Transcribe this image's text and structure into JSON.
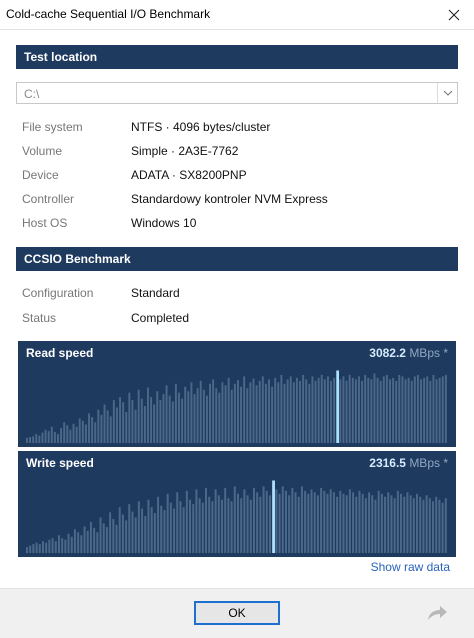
{
  "window": {
    "title": "Cold-cache Sequential I/O Benchmark"
  },
  "icons": {
    "close": "close-icon",
    "dropdown": "chevron-down-icon",
    "share": "share-arrow-icon"
  },
  "colors": {
    "header": "#1f3a5f",
    "bar": "#4c6889",
    "marker": "#aee0ff",
    "link": "#2a62b8"
  },
  "location": {
    "header": "Test location",
    "drive": "C:\\",
    "rows": [
      {
        "key": "File system",
        "value": "NTFS  ·  4096 bytes/cluster"
      },
      {
        "key": "Volume",
        "value": "Simple  ·  2A3E-7762"
      },
      {
        "key": "Device",
        "value": "ADATA  ·  SX8200PNP"
      },
      {
        "key": "Controller",
        "value": "Standardowy kontroler NVM Express"
      },
      {
        "key": "Host OS",
        "value": "Windows 10"
      }
    ]
  },
  "benchmark": {
    "header": "CCSIO Benchmark",
    "rows": [
      {
        "key": "Configuration",
        "value": "Standard"
      },
      {
        "key": "Status",
        "value": "Completed"
      }
    ]
  },
  "read": {
    "label": "Read speed",
    "value": "3082.2",
    "unit": "MBps *",
    "marker_index": 100,
    "levels": [
      0.07,
      0.08,
      0.09,
      0.12,
      0.1,
      0.14,
      0.18,
      0.16,
      0.22,
      0.15,
      0.12,
      0.2,
      0.28,
      0.24,
      0.18,
      0.26,
      0.22,
      0.33,
      0.3,
      0.25,
      0.4,
      0.35,
      0.28,
      0.45,
      0.38,
      0.52,
      0.44,
      0.36,
      0.58,
      0.48,
      0.62,
      0.55,
      0.42,
      0.68,
      0.58,
      0.45,
      0.72,
      0.6,
      0.5,
      0.75,
      0.62,
      0.52,
      0.7,
      0.58,
      0.66,
      0.78,
      0.64,
      0.56,
      0.8,
      0.68,
      0.6,
      0.76,
      0.7,
      0.82,
      0.66,
      0.74,
      0.84,
      0.72,
      0.64,
      0.8,
      0.86,
      0.74,
      0.68,
      0.82,
      0.78,
      0.88,
      0.72,
      0.8,
      0.85,
      0.76,
      0.9,
      0.74,
      0.82,
      0.87,
      0.78,
      0.84,
      0.9,
      0.8,
      0.86,
      0.76,
      0.88,
      0.82,
      0.92,
      0.8,
      0.86,
      0.9,
      0.82,
      0.88,
      0.84,
      0.92,
      0.86,
      0.8,
      0.9,
      0.84,
      0.88,
      0.92,
      0.86,
      0.9,
      0.84,
      0.88,
      0.98,
      0.86,
      0.9,
      0.84,
      0.92,
      0.88,
      0.86,
      0.9,
      0.84,
      0.92,
      0.88,
      0.86,
      0.94,
      0.88,
      0.84,
      0.9,
      0.92,
      0.86,
      0.88,
      0.84,
      0.92,
      0.9,
      0.86,
      0.88,
      0.84,
      0.9,
      0.92,
      0.86,
      0.88,
      0.9,
      0.84,
      0.92,
      0.86,
      0.88,
      0.9,
      0.92
    ]
  },
  "write": {
    "label": "Write speed",
    "value": "2316.5",
    "unit": "MBps *",
    "marker_index": 77,
    "levels": [
      0.08,
      0.1,
      0.12,
      0.14,
      0.12,
      0.16,
      0.14,
      0.18,
      0.2,
      0.16,
      0.24,
      0.2,
      0.18,
      0.26,
      0.22,
      0.32,
      0.28,
      0.24,
      0.36,
      0.3,
      0.42,
      0.34,
      0.28,
      0.48,
      0.4,
      0.35,
      0.55,
      0.46,
      0.38,
      0.62,
      0.52,
      0.44,
      0.66,
      0.56,
      0.48,
      0.7,
      0.6,
      0.5,
      0.72,
      0.62,
      0.54,
      0.76,
      0.64,
      0.58,
      0.8,
      0.68,
      0.6,
      0.82,
      0.7,
      0.62,
      0.84,
      0.72,
      0.66,
      0.86,
      0.74,
      0.68,
      0.88,
      0.76,
      0.7,
      0.86,
      0.78,
      0.72,
      0.88,
      0.74,
      0.7,
      0.9,
      0.8,
      0.74,
      0.86,
      0.78,
      0.72,
      0.88,
      0.82,
      0.76,
      0.9,
      0.84,
      0.78,
      0.98,
      0.86,
      0.8,
      0.9,
      0.84,
      0.78,
      0.88,
      0.82,
      0.76,
      0.9,
      0.84,
      0.8,
      0.86,
      0.82,
      0.78,
      0.88,
      0.84,
      0.8,
      0.86,
      0.82,
      0.76,
      0.84,
      0.8,
      0.78,
      0.86,
      0.82,
      0.76,
      0.84,
      0.8,
      0.74,
      0.82,
      0.78,
      0.72,
      0.84,
      0.8,
      0.76,
      0.82,
      0.78,
      0.74,
      0.84,
      0.8,
      0.76,
      0.82,
      0.78,
      0.74,
      0.8,
      0.76,
      0.72,
      0.78,
      0.74,
      0.7,
      0.76,
      0.72,
      0.68,
      0.74
    ]
  },
  "footer": {
    "link": "Show raw data",
    "ok": "OK"
  }
}
